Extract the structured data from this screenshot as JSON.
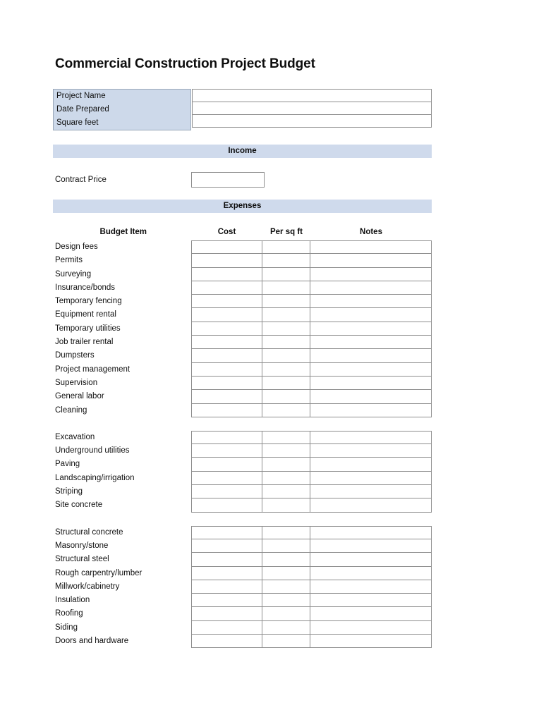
{
  "document": {
    "title": "Commercial Construction Project Budget"
  },
  "project_info": {
    "rows": [
      {
        "label": "Project Name",
        "value": ""
      },
      {
        "label": "Date Prepared",
        "value": ""
      },
      {
        "label": "Square feet",
        "value": ""
      }
    ]
  },
  "income": {
    "banner": "Income",
    "contract_price_label": "Contract Price",
    "contract_price_value": ""
  },
  "expenses": {
    "banner": "Expenses",
    "columns": [
      "Budget Item",
      "Cost",
      "Per sq ft",
      "Notes"
    ],
    "groups": [
      {
        "items": [
          {
            "label": "Design fees",
            "cost": "",
            "per_sq_ft": "",
            "notes": ""
          },
          {
            "label": "Permits",
            "cost": "",
            "per_sq_ft": "",
            "notes": ""
          },
          {
            "label": "Surveying",
            "cost": "",
            "per_sq_ft": "",
            "notes": ""
          },
          {
            "label": "Insurance/bonds",
            "cost": "",
            "per_sq_ft": "",
            "notes": ""
          },
          {
            "label": "Temporary fencing",
            "cost": "",
            "per_sq_ft": "",
            "notes": ""
          },
          {
            "label": "Equipment rental",
            "cost": "",
            "per_sq_ft": "",
            "notes": ""
          },
          {
            "label": "Temporary utilities",
            "cost": "",
            "per_sq_ft": "",
            "notes": ""
          },
          {
            "label": "Job trailer rental",
            "cost": "",
            "per_sq_ft": "",
            "notes": ""
          },
          {
            "label": "Dumpsters",
            "cost": "",
            "per_sq_ft": "",
            "notes": ""
          },
          {
            "label": "Project management",
            "cost": "",
            "per_sq_ft": "",
            "notes": ""
          },
          {
            "label": "Supervision",
            "cost": "",
            "per_sq_ft": "",
            "notes": ""
          },
          {
            "label": "General labor",
            "cost": "",
            "per_sq_ft": "",
            "notes": ""
          },
          {
            "label": "Cleaning",
            "cost": "",
            "per_sq_ft": "",
            "notes": ""
          }
        ]
      },
      {
        "items": [
          {
            "label": "Excavation",
            "cost": "",
            "per_sq_ft": "",
            "notes": ""
          },
          {
            "label": "Underground utilities",
            "cost": "",
            "per_sq_ft": "",
            "notes": ""
          },
          {
            "label": "Paving",
            "cost": "",
            "per_sq_ft": "",
            "notes": ""
          },
          {
            "label": "Landscaping/irrigation",
            "cost": "",
            "per_sq_ft": "",
            "notes": ""
          },
          {
            "label": "Striping",
            "cost": "",
            "per_sq_ft": "",
            "notes": ""
          },
          {
            "label": "Site concrete",
            "cost": "",
            "per_sq_ft": "",
            "notes": ""
          }
        ]
      },
      {
        "items": [
          {
            "label": "Structural concrete",
            "cost": "",
            "per_sq_ft": "",
            "notes": ""
          },
          {
            "label": "Masonry/stone",
            "cost": "",
            "per_sq_ft": "",
            "notes": ""
          },
          {
            "label": "Structural steel",
            "cost": "",
            "per_sq_ft": "",
            "notes": ""
          },
          {
            "label": "Rough carpentry/lumber",
            "cost": "",
            "per_sq_ft": "",
            "notes": ""
          },
          {
            "label": "Millwork/cabinetry",
            "cost": "",
            "per_sq_ft": "",
            "notes": ""
          },
          {
            "label": "Insulation",
            "cost": "",
            "per_sq_ft": "",
            "notes": ""
          },
          {
            "label": "Roofing",
            "cost": "",
            "per_sq_ft": "",
            "notes": ""
          },
          {
            "label": "Siding",
            "cost": "",
            "per_sq_ft": "",
            "notes": ""
          },
          {
            "label": "Doors and hardware",
            "cost": "",
            "per_sq_ft": "",
            "notes": ""
          }
        ]
      }
    ]
  },
  "colors": {
    "banner_fill": "#cfdaec",
    "info_label_fill": "#cdd9ea",
    "cell_border": "#8d8d8d",
    "text": "#111111",
    "page_background": "#ffffff"
  }
}
